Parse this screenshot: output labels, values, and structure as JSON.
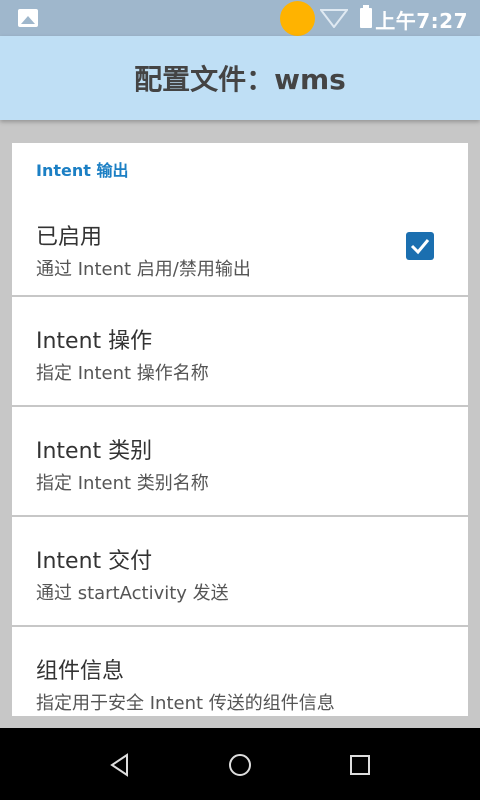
{
  "status_bar": {
    "time": "上午7:27"
  },
  "app_bar": {
    "title": "配置文件：wms"
  },
  "section": {
    "title": "Intent 输出"
  },
  "prefs": [
    {
      "title": "已启用",
      "summary": "通过 Intent 启用/禁用输出",
      "checked": true
    },
    {
      "title": "Intent 操作",
      "summary": "指定 Intent 操作名称"
    },
    {
      "title": "Intent 类别",
      "summary": "指定 Intent 类别名称"
    },
    {
      "title": "Intent 交付",
      "summary": "通过 startActivity 发送"
    },
    {
      "title": "组件信息",
      "summary": "指定用于安全 Intent 传送的组件信息"
    }
  ],
  "colors": {
    "accent": "#1b7fc4",
    "app_bar": "#bfdff5",
    "status_bar": "#9fb7cc"
  },
  "icons": [
    "gallery-icon",
    "wifi-icon",
    "battery-icon",
    "back-icon",
    "home-icon",
    "recents-icon"
  ]
}
